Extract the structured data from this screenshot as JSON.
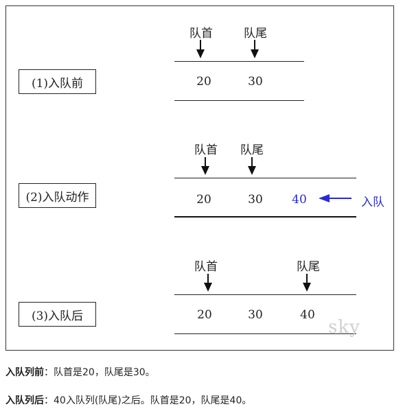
{
  "stages": [
    {
      "label": "(1)入队前",
      "head_label": "队首",
      "tail_label": "队尾",
      "values": [
        "20",
        "30"
      ]
    },
    {
      "label": "(2)入队动作",
      "head_label": "队首",
      "tail_label": "队尾",
      "values": [
        "20",
        "30"
      ],
      "incoming_value": "40",
      "incoming_label": "入队"
    },
    {
      "label": "(3)入队后",
      "head_label": "队首",
      "tail_label": "队尾",
      "values": [
        "20",
        "30",
        "40"
      ]
    }
  ],
  "watermark": "sky",
  "captions": [
    {
      "term": "入队列前",
      "text": "：队首是20，队尾是30。"
    },
    {
      "term": "入队列后",
      "text": "：40入队列(队尾)之后。队首是20，队尾是40。"
    }
  ],
  "colors": {
    "line": "#222222",
    "accent": "#2a2ad6",
    "watermark": "#cfcfcf"
  }
}
